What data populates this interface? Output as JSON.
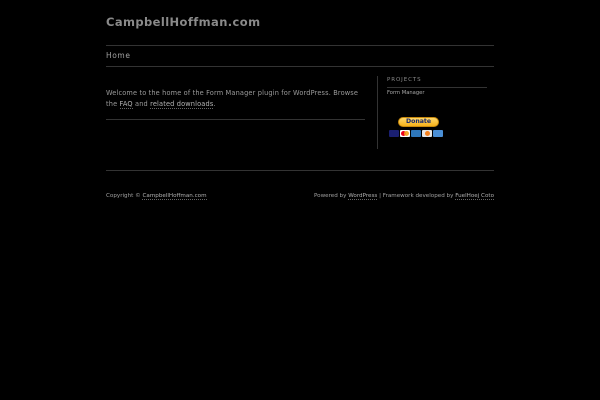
{
  "header": {
    "site_title": "CampbellHoffman.com"
  },
  "nav": {
    "home_label": "Home"
  },
  "main": {
    "intro_prefix": "Welcome to the home of the Form Manager plugin for WordPress. Browse the ",
    "faq_link": "FAQ",
    "intro_and": " and ",
    "downloads_link": "related downloads",
    "intro_suffix": "."
  },
  "sidebar": {
    "widget_title": "PROJECTS",
    "links": [
      "Form Manager"
    ],
    "donate_label": "Donate",
    "card_icons": [
      "visa-icon",
      "mastercard-icon",
      "amex-icon",
      "discover-icon",
      "card-icon"
    ]
  },
  "footer": {
    "copyright_prefix": "Copyright © ",
    "copyright_link": "CampbellHoffman.com",
    "powered_prefix": "Powered by ",
    "powered_link": "WordPress",
    "framework_text": " | Framework developed by ",
    "framework_link": "FuelHoej Coto"
  },
  "colors": {
    "background": "#000000",
    "text": "#9a9a9a",
    "rule": "#333333",
    "donate_gold": "#f7b21a"
  }
}
